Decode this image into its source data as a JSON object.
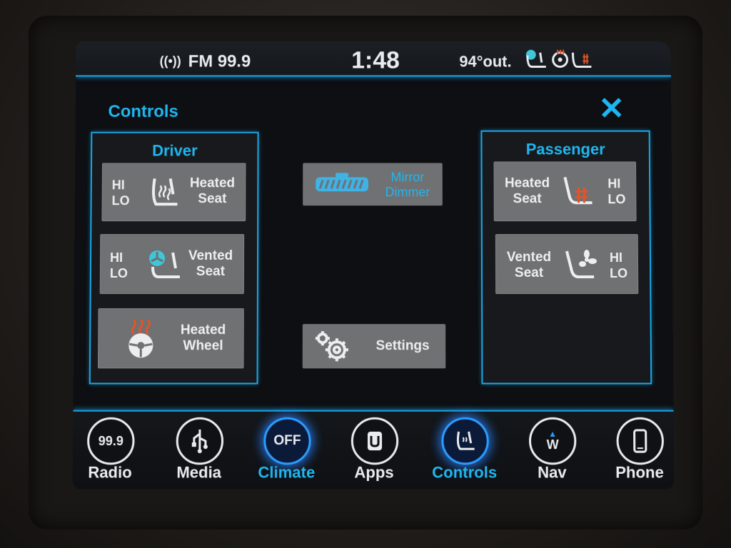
{
  "status_bar": {
    "radio": "FM 99.9",
    "time": "1:48",
    "outside_temp": "94°out."
  },
  "page": {
    "title": "Controls",
    "close_label": "✕"
  },
  "driver": {
    "title": "Driver",
    "heated_seat": {
      "label_1": "Heated",
      "label_2": "Seat",
      "hi": "HI",
      "lo": "LO"
    },
    "vented_seat": {
      "label_1": "Vented",
      "label_2": "Seat",
      "hi": "HI",
      "lo": "LO"
    },
    "heated_wheel": {
      "label_1": "Heated",
      "label_2": "Wheel"
    }
  },
  "center": {
    "mirror_dimmer": {
      "label_1": "Mirror",
      "label_2": "Dimmer"
    },
    "settings": {
      "label": "Settings"
    }
  },
  "passenger": {
    "title": "Passenger",
    "heated_seat": {
      "label_1": "Heated",
      "label_2": "Seat",
      "hi": "HI",
      "lo": "LO"
    },
    "vented_seat": {
      "label_1": "Vented",
      "label_2": "Seat",
      "hi": "HI",
      "lo": "LO"
    }
  },
  "nav": [
    {
      "label": "Radio",
      "icon_text": "99.9",
      "active": false
    },
    {
      "label": "Media",
      "icon_text": "",
      "active": false
    },
    {
      "label": "Climate",
      "icon_text": "OFF",
      "active": true
    },
    {
      "label": "Apps",
      "icon_text": "",
      "active": false
    },
    {
      "label": "Controls",
      "icon_text": "",
      "active": true
    },
    {
      "label": "Nav",
      "icon_text": "W",
      "active": false
    },
    {
      "label": "Phone",
      "icon_text": "",
      "active": false
    }
  ],
  "colors": {
    "accent": "#1fb6f0",
    "heat": "#e2542a",
    "vent": "#3fc6d8",
    "button": "#6f7173"
  }
}
